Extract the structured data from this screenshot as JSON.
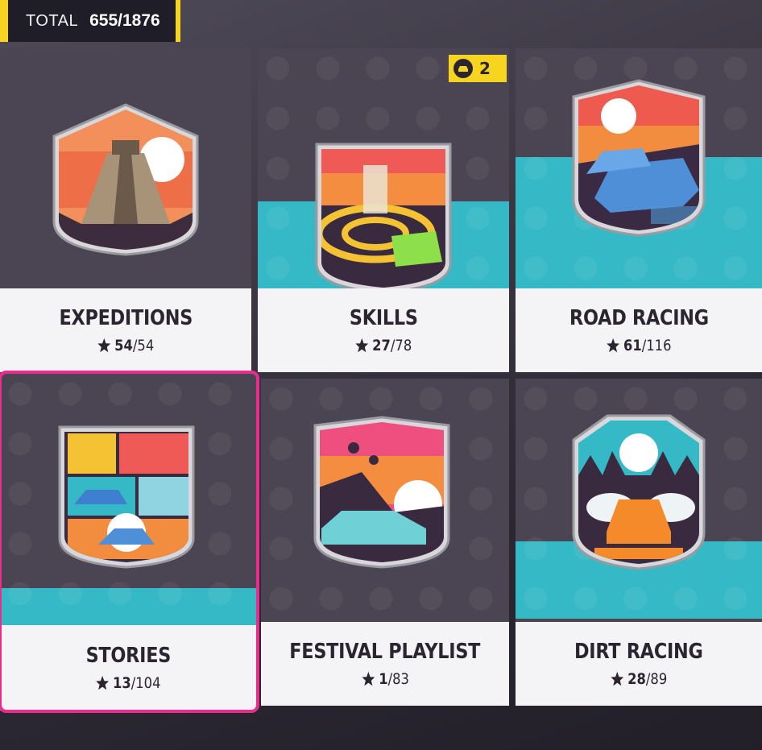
{
  "total": {
    "label": "TOTAL",
    "value": "655/1876"
  },
  "skills_badge": {
    "count": "2",
    "icon": "car-icon"
  },
  "cards": [
    {
      "title": "EXPEDITIONS",
      "done": "54",
      "all": "54",
      "icon": "pyramid-emblem-icon",
      "completed": true
    },
    {
      "title": "SKILLS",
      "done": "27",
      "all": "78",
      "icon": "skills-emblem-icon"
    },
    {
      "title": "ROAD RACING",
      "done": "61",
      "all": "116",
      "icon": "road-racing-emblem-icon"
    },
    {
      "title": "STORIES",
      "done": "13",
      "all": "104",
      "icon": "stories-emblem-icon",
      "selected": true
    },
    {
      "title": "FESTIVAL PLAYLIST",
      "done": "1",
      "all": "83",
      "icon": "festival-emblem-icon"
    },
    {
      "title": "DIRT RACING",
      "done": "28",
      "all": "89",
      "icon": "dirt-racing-emblem-icon"
    }
  ],
  "colors": {
    "accent": "#f7d41f",
    "select": "#ea2c8f",
    "teal": "#36b9c6",
    "dark": "#2b2530"
  }
}
